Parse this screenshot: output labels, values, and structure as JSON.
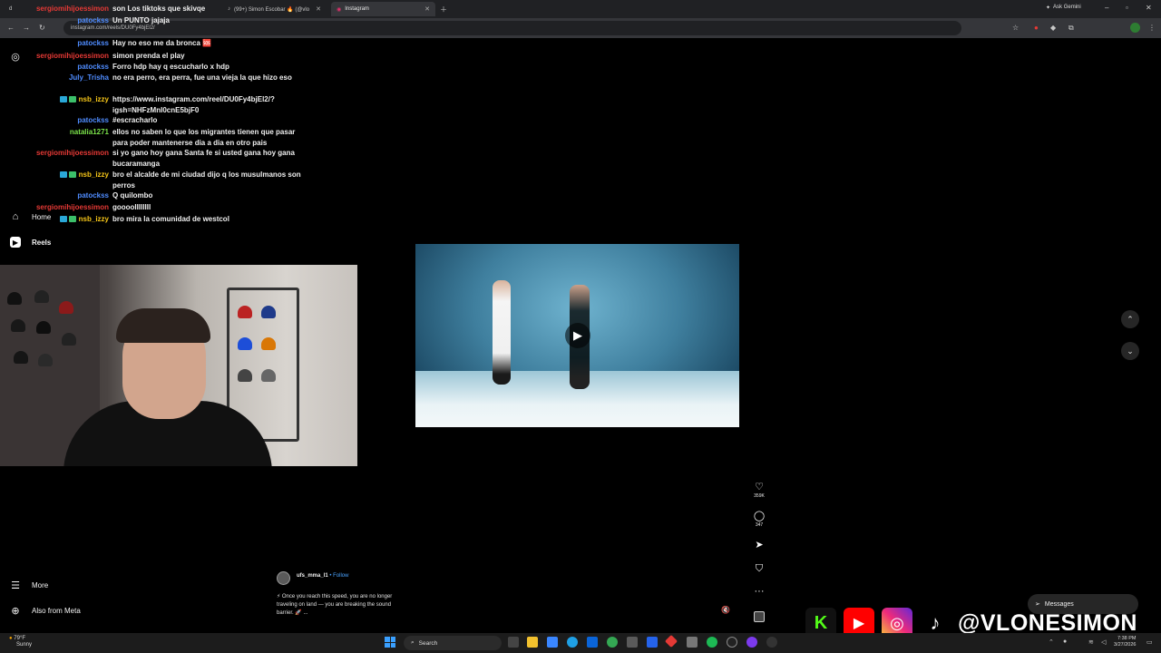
{
  "browser": {
    "tabs": [
      {
        "label": "d"
      },
      {
        "label": "(99+) Simon Escobar 🔥 (@vlo"
      },
      {
        "label": "Instagram"
      }
    ],
    "url": "instagram.com/reels/DU0Fy4bjEl2/",
    "ask_gemini": "Ask Gemini"
  },
  "sidebar": {
    "home": "Home",
    "reels": "Reels",
    "more": "More",
    "also_from_meta": "Also from Meta"
  },
  "chat": [
    {
      "user": "sergiomihijoessimon",
      "color": "#e53935",
      "text": "son Los tiktoks que skivqe",
      "badge": false
    },
    {
      "user": "patockss",
      "color": "#4f8cff",
      "text": "Un PUNTO jajaja",
      "badge": false
    },
    {
      "user": "patockss",
      "color": "#4f8cff",
      "text": "Hay no eso me da bronca 🆘",
      "badge": false
    },
    {
      "user": "sergiomihijoessimon",
      "color": "#e53935",
      "text": "simon prenda el play",
      "badge": false
    },
    {
      "user": "patockss",
      "color": "#4f8cff",
      "text": "Forro hdp hay q escucharlo x hdp",
      "badge": false
    },
    {
      "user": "July_Trisha",
      "color": "#4f8cff",
      "text": "no era perro, era perra, fue una vieja la que hizo eso",
      "badge": false
    },
    {
      "user": "nsb_izzy",
      "color": "#f5c518",
      "text": "https://www.instagram.com/reel/DU0Fy4bjEl2/?igsh=NHFzMnI0cnE5bjF0",
      "badge": true,
      "link": true
    },
    {
      "user": "patockss",
      "color": "#4f8cff",
      "text": "#escracharlo",
      "badge": false
    },
    {
      "user": "natalia1271",
      "color": "#7be34a",
      "text": "ellos no saben lo que los migrantes tienen que pasar para poder mantenerse dia a dia en otro pais",
      "badge": false
    },
    {
      "user": "sergiomihijoessimon",
      "color": "#e53935",
      "text": "si yo gano hoy gana Santa fe si usted gana hoy gana bucaramanga",
      "badge": false
    },
    {
      "user": "nsb_izzy",
      "color": "#f5c518",
      "text": "bro el alcalde de mi ciudad dijo q los musulmanos son perros",
      "badge": true
    },
    {
      "user": "patockss",
      "color": "#4f8cff",
      "text": "Q quilombo",
      "badge": false
    },
    {
      "user": "sergiomihijoessimon",
      "color": "#e53935",
      "text": "gooooIIIIIIII",
      "badge": false
    },
    {
      "user": "nsb_izzy",
      "color": "#f5c518",
      "text": "bro mira la comunidad de westcol",
      "badge": true
    }
  ],
  "reel": {
    "likes": "359K",
    "comments": "347",
    "caption_user": "ufs_mma_l1",
    "follow": "• Follow",
    "caption": "⚡ Once you reach this speed, you are no longer traveling on land — you are breaking the sound barrier. 🚀 ..."
  },
  "messages_label": "Messages",
  "branding": {
    "handle": "@VLONESIMON"
  },
  "taskbar": {
    "weather_temp": "79°F",
    "weather_desc": "Sunny",
    "search": "Search",
    "time": "7:38 PM",
    "date": "3/27/2026"
  },
  "icons": {
    "heart": "heart-icon",
    "comment": "comment-icon",
    "share": "share-icon",
    "save": "bookmark-icon",
    "more": "more-icon"
  }
}
